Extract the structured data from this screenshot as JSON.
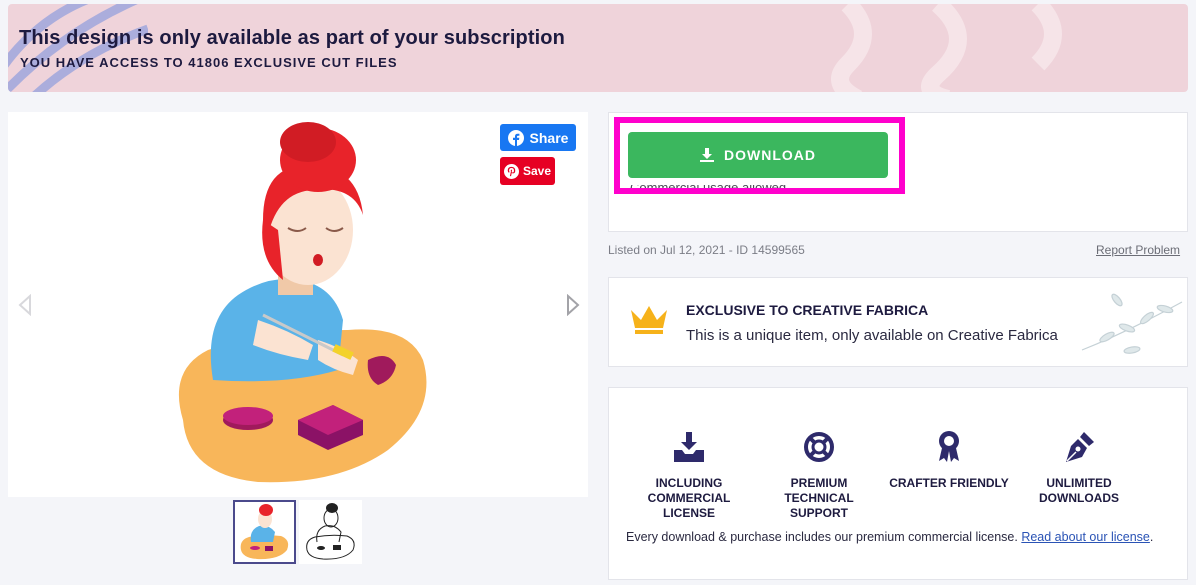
{
  "banner": {
    "title": "This design is only available as part of your subscription",
    "subtitle": "YOU HAVE ACCESS TO 41806 EXCLUSIVE CUT FILES"
  },
  "preview": {
    "share_label": "Share",
    "save_label": "Save",
    "thumbnail_count": 2
  },
  "download": {
    "button_label": "DOWNLOAD",
    "commercial_note": "Commercial usage allowed.",
    "accent_color": "#3bb75e"
  },
  "listing": {
    "listed_text": "Listed on Jul 12, 2021 - ID 14599565",
    "report_label": "Report Problem"
  },
  "exclusive": {
    "title": "EXCLUSIVE TO CREATIVE FABRICA",
    "text": "This is a unique item, only available on Creative Fabrica"
  },
  "features": {
    "items": [
      {
        "label": "INCLUDING COMMERCIAL LICENSE",
        "icon": "download-tray-icon"
      },
      {
        "label": "PREMIUM TECHNICAL SUPPORT",
        "icon": "lifebuoy-icon"
      },
      {
        "label": "CRAFTER FRIENDLY",
        "icon": "award-ribbon-icon"
      },
      {
        "label": "UNLIMITED DOWNLOADS",
        "icon": "pen-nib-icon"
      }
    ],
    "note": "Every download & purchase includes our premium commercial license.",
    "note_link": "Read about our license"
  }
}
